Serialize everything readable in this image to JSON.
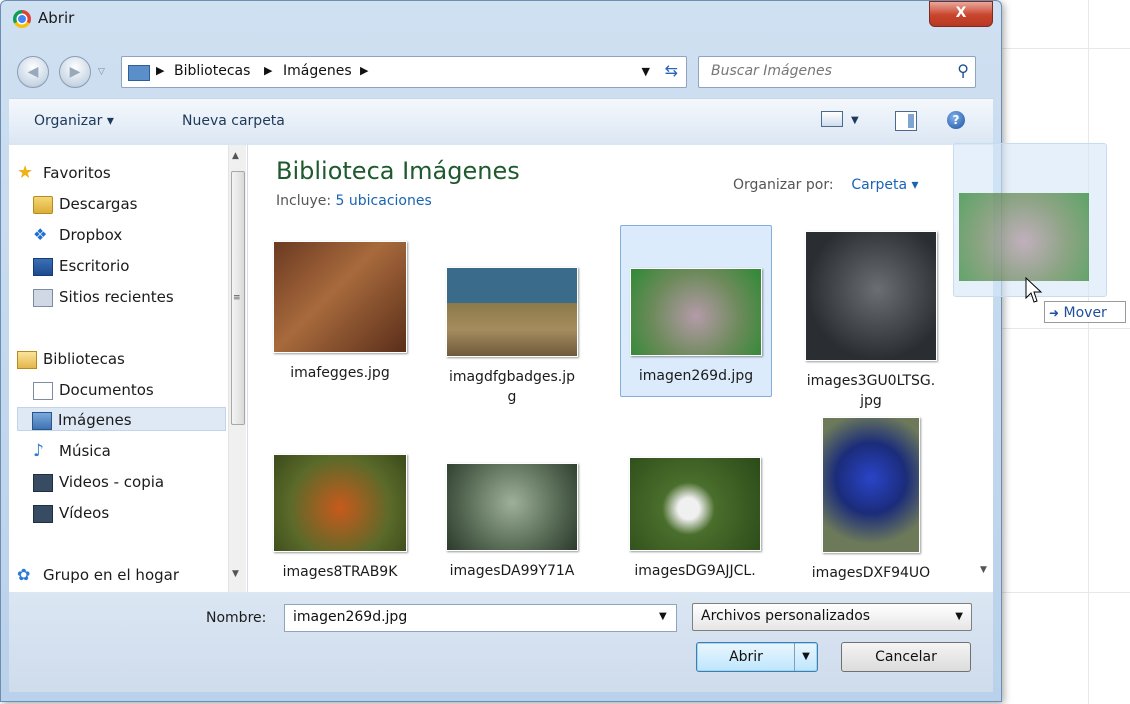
{
  "window": {
    "title": "Abrir",
    "close_label": "X"
  },
  "address": {
    "crumbs": [
      "Bibliotecas",
      "Imágenes"
    ],
    "search_placeholder": "Buscar Imágenes"
  },
  "toolbar": {
    "organize_label": "Organizar ▾",
    "new_folder_label": "Nueva carpeta",
    "help_label": "?"
  },
  "sidebar": {
    "groups": [
      {
        "label": "Favoritos",
        "icon": "star-icon",
        "items": [
          {
            "label": "Descargas",
            "icon": "downloads-folder-icon"
          },
          {
            "label": "Dropbox",
            "icon": "dropbox-icon"
          },
          {
            "label": "Escritorio",
            "icon": "desktop-icon"
          },
          {
            "label": "Sitios recientes",
            "icon": "recent-places-icon"
          }
        ]
      },
      {
        "label": "Bibliotecas",
        "icon": "library-icon",
        "items": [
          {
            "label": "Documentos",
            "icon": "documents-icon"
          },
          {
            "label": "Imágenes",
            "icon": "pictures-icon",
            "selected": true
          },
          {
            "label": "Música",
            "icon": "music-icon"
          },
          {
            "label": "Videos - copia",
            "icon": "video-icon"
          },
          {
            "label": "Vídeos",
            "icon": "video-icon"
          }
        ]
      },
      {
        "label": "Grupo en el hogar",
        "icon": "homegroup-icon",
        "items": []
      }
    ]
  },
  "library": {
    "title": "Biblioteca Imágenes",
    "includes_label": "Incluye:",
    "includes_link": "5 ubicaciones",
    "arrange_label": "Organizar por:",
    "arrange_value": "Carpeta ▾"
  },
  "files": [
    {
      "name": "imafegges.jpg"
    },
    {
      "name": "imagdfgbadges.jpg"
    },
    {
      "name": "imagen269d.jpg",
      "selected": true
    },
    {
      "name": "images3GU0LTSG.jpg"
    },
    {
      "name": "images8TRAB9K"
    },
    {
      "name": "imagesDA99Y71A"
    },
    {
      "name": "imagesDG9AJJCL."
    },
    {
      "name": "imagesDXF94UO"
    }
  ],
  "bottom": {
    "filename_label": "Nombre:",
    "filename_value": "imagen269d.jpg",
    "filter_value": "Archivos personalizados",
    "open_label": "Abrir",
    "cancel_label": "Cancelar"
  },
  "drag": {
    "hint": "Mover"
  },
  "colors": {
    "library_title": "#1e5a2e",
    "link": "#1a64b4",
    "selection": "#dcebfc"
  }
}
